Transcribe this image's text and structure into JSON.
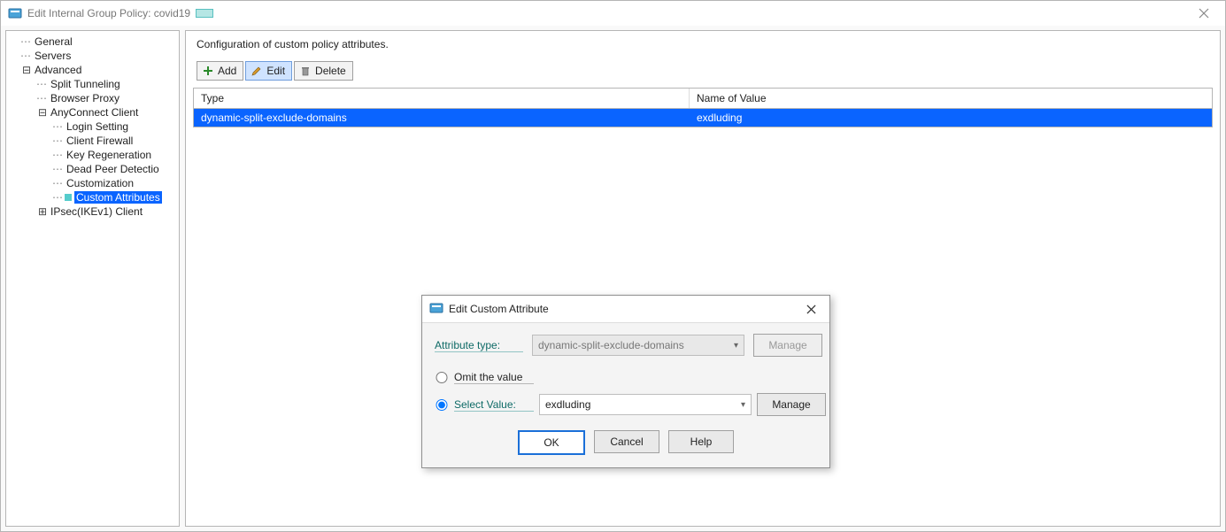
{
  "window": {
    "title": "Edit Internal Group Policy: covid19",
    "close_icon": "close-icon"
  },
  "tree": {
    "items": [
      {
        "label": "General",
        "level": 1,
        "expandable": false
      },
      {
        "label": "Servers",
        "level": 1,
        "expandable": false
      },
      {
        "label": "Advanced",
        "level": 1,
        "expandable": true,
        "expanded": true
      },
      {
        "label": "Split Tunneling",
        "level": 2
      },
      {
        "label": "Browser Proxy",
        "level": 2
      },
      {
        "label": "AnyConnect Client",
        "level": 2,
        "expandable": true,
        "expanded": true
      },
      {
        "label": "Login Setting",
        "level": 3
      },
      {
        "label": "Client Firewall",
        "level": 3
      },
      {
        "label": "Key Regeneration",
        "level": 3
      },
      {
        "label": "Dead Peer Detectio",
        "level": 3
      },
      {
        "label": "Customization",
        "level": 3
      },
      {
        "label": "Custom Attributes",
        "level": 3,
        "selected": true,
        "teal": true
      },
      {
        "label": "IPsec(IKEv1) Client",
        "level": 2,
        "expandable": true,
        "expanded": false
      }
    ]
  },
  "detail": {
    "heading": "Configuration of custom policy attributes.",
    "toolbar": {
      "add_label": "Add",
      "edit_label": "Edit",
      "delete_label": "Delete"
    },
    "grid": {
      "headers": {
        "type": "Type",
        "name": "Name of Value"
      },
      "rows": [
        {
          "type": "dynamic-split-exclude-domains",
          "name": "exdluding"
        }
      ]
    }
  },
  "modal": {
    "title": "Edit Custom Attribute",
    "attr_type_label": "Attribute type:",
    "attr_type_value": "dynamic-split-exclude-domains",
    "manage_label": "Manage",
    "omit_label": "Omit the value",
    "select_label": "Select Value:",
    "select_value": "exdluding",
    "buttons": {
      "ok": "OK",
      "cancel": "Cancel",
      "help": "Help"
    },
    "radio_selected": "select"
  }
}
